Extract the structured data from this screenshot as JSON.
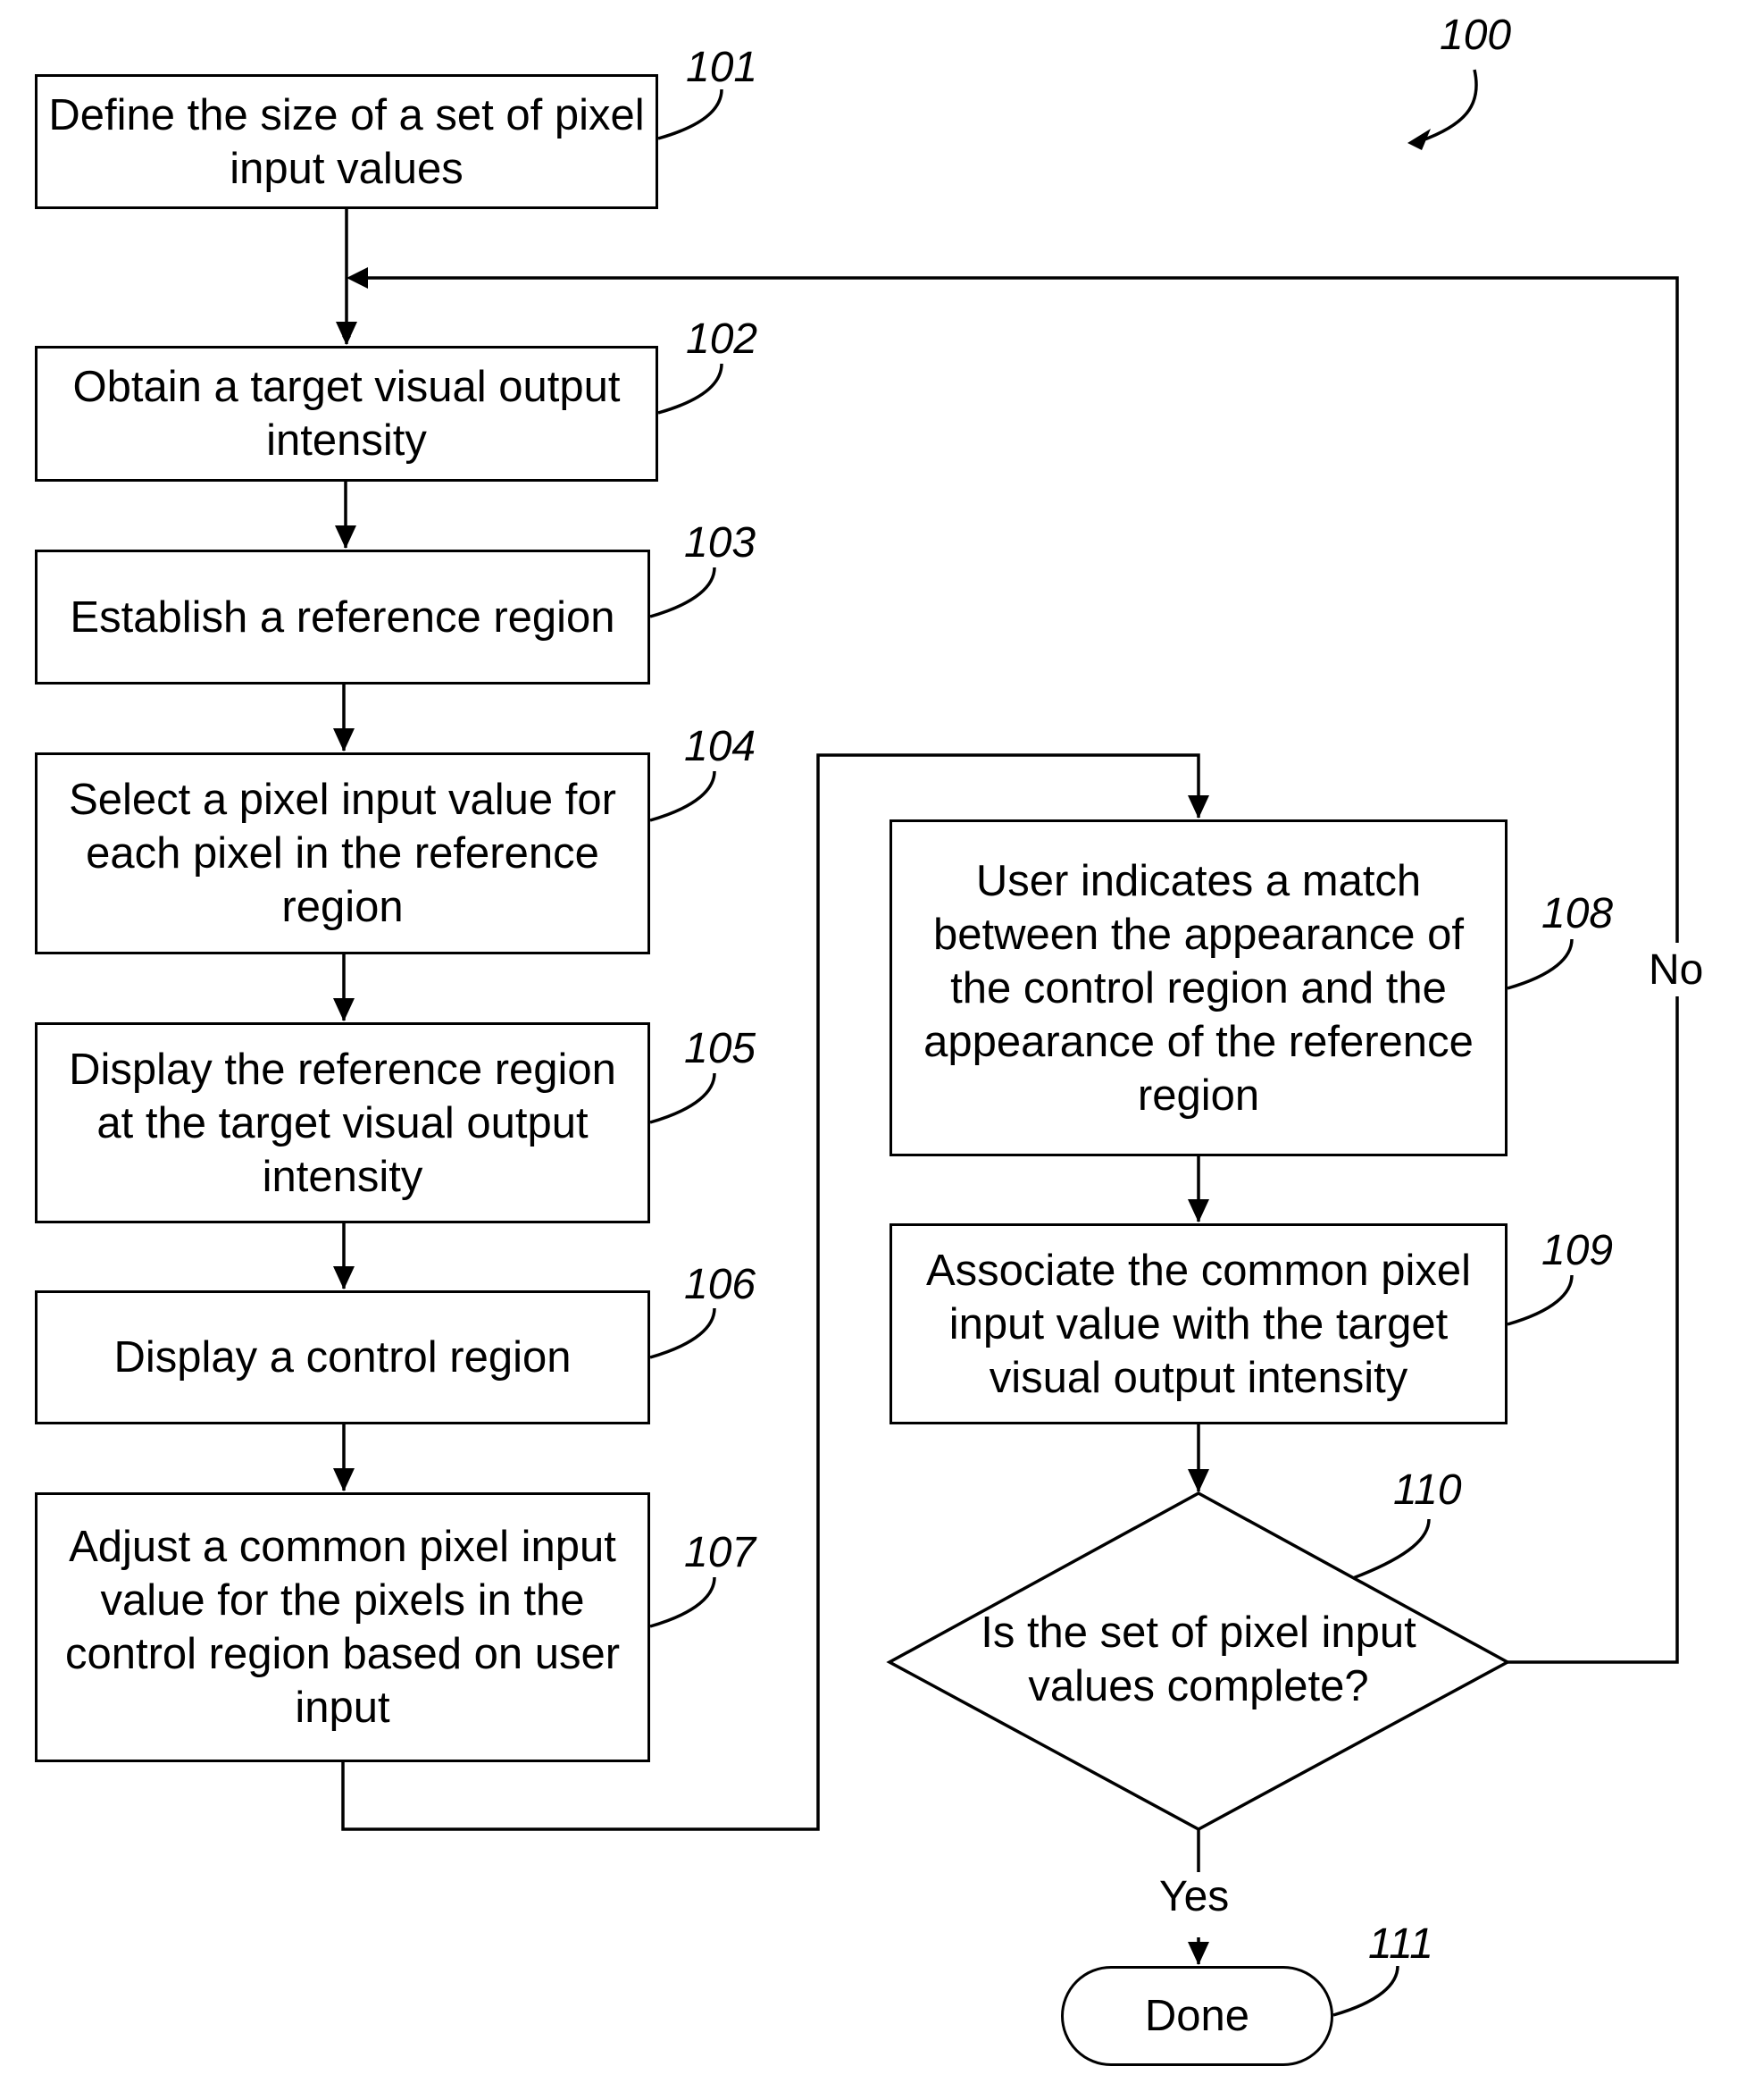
{
  "figure": {
    "ref": "100",
    "steps": [
      {
        "ref": "101",
        "text": "Define the size of a set of pixel input values"
      },
      {
        "ref": "102",
        "text": "Obtain a target visual output intensity"
      },
      {
        "ref": "103",
        "text": "Establish a reference region"
      },
      {
        "ref": "104",
        "text": "Select a pixel input value for each pixel in the reference region"
      },
      {
        "ref": "105",
        "text": "Display the reference region at the target visual output intensity"
      },
      {
        "ref": "106",
        "text": "Display a control region"
      },
      {
        "ref": "107",
        "text": "Adjust a common pixel input value for the pixels in the control region based on user input"
      },
      {
        "ref": "108",
        "text": "User indicates a match between the appearance of the control region and the appearance of the reference region"
      },
      {
        "ref": "109",
        "text": "Associate the common pixel input value with the target visual output intensity"
      }
    ],
    "decision": {
      "ref": "110",
      "text": "Is the set of pixel input values complete?",
      "yes_label": "Yes",
      "no_label": "No"
    },
    "terminal": {
      "ref": "111",
      "text": "Done"
    }
  }
}
